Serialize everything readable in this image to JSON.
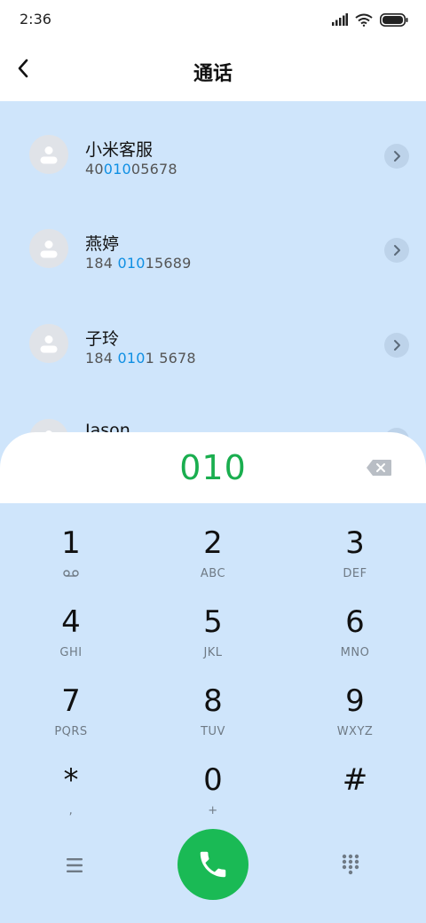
{
  "status": {
    "time": "2:36"
  },
  "header": {
    "title": "通话"
  },
  "contacts": [
    {
      "name": "小米客服",
      "number": [
        {
          "t": "40",
          "hl": false
        },
        {
          "t": "010",
          "hl": true
        },
        {
          "t": "05678",
          "hl": false
        }
      ]
    },
    {
      "name": "燕婷",
      "number": [
        {
          "t": "184 ",
          "hl": false
        },
        {
          "t": "010",
          "hl": true
        },
        {
          "t": "15689",
          "hl": false
        }
      ]
    },
    {
      "name": "子玲",
      "number": [
        {
          "t": "184 ",
          "hl": false
        },
        {
          "t": "010",
          "hl": true
        },
        {
          "t": "1 5678",
          "hl": false
        }
      ]
    },
    {
      "name": "Jason",
      "number": []
    }
  ],
  "dialer": {
    "entered": "010",
    "keys": [
      {
        "num": "1",
        "sub": ""
      },
      {
        "num": "2",
        "sub": "ABC"
      },
      {
        "num": "3",
        "sub": "DEF"
      },
      {
        "num": "4",
        "sub": "GHI"
      },
      {
        "num": "5",
        "sub": "JKL"
      },
      {
        "num": "6",
        "sub": "MNO"
      },
      {
        "num": "7",
        "sub": "PQRS"
      },
      {
        "num": "8",
        "sub": "TUV"
      },
      {
        "num": "9",
        "sub": "WXYZ"
      },
      {
        "num": "*",
        "sub": ","
      },
      {
        "num": "0",
        "sub": "+"
      },
      {
        "num": "#",
        "sub": ""
      }
    ],
    "key1_icon": "voicemail-icon"
  },
  "colors": {
    "accent_green": "#1aba55",
    "highlight_blue": "#0f8fe3",
    "background": "#cfe5fb"
  }
}
